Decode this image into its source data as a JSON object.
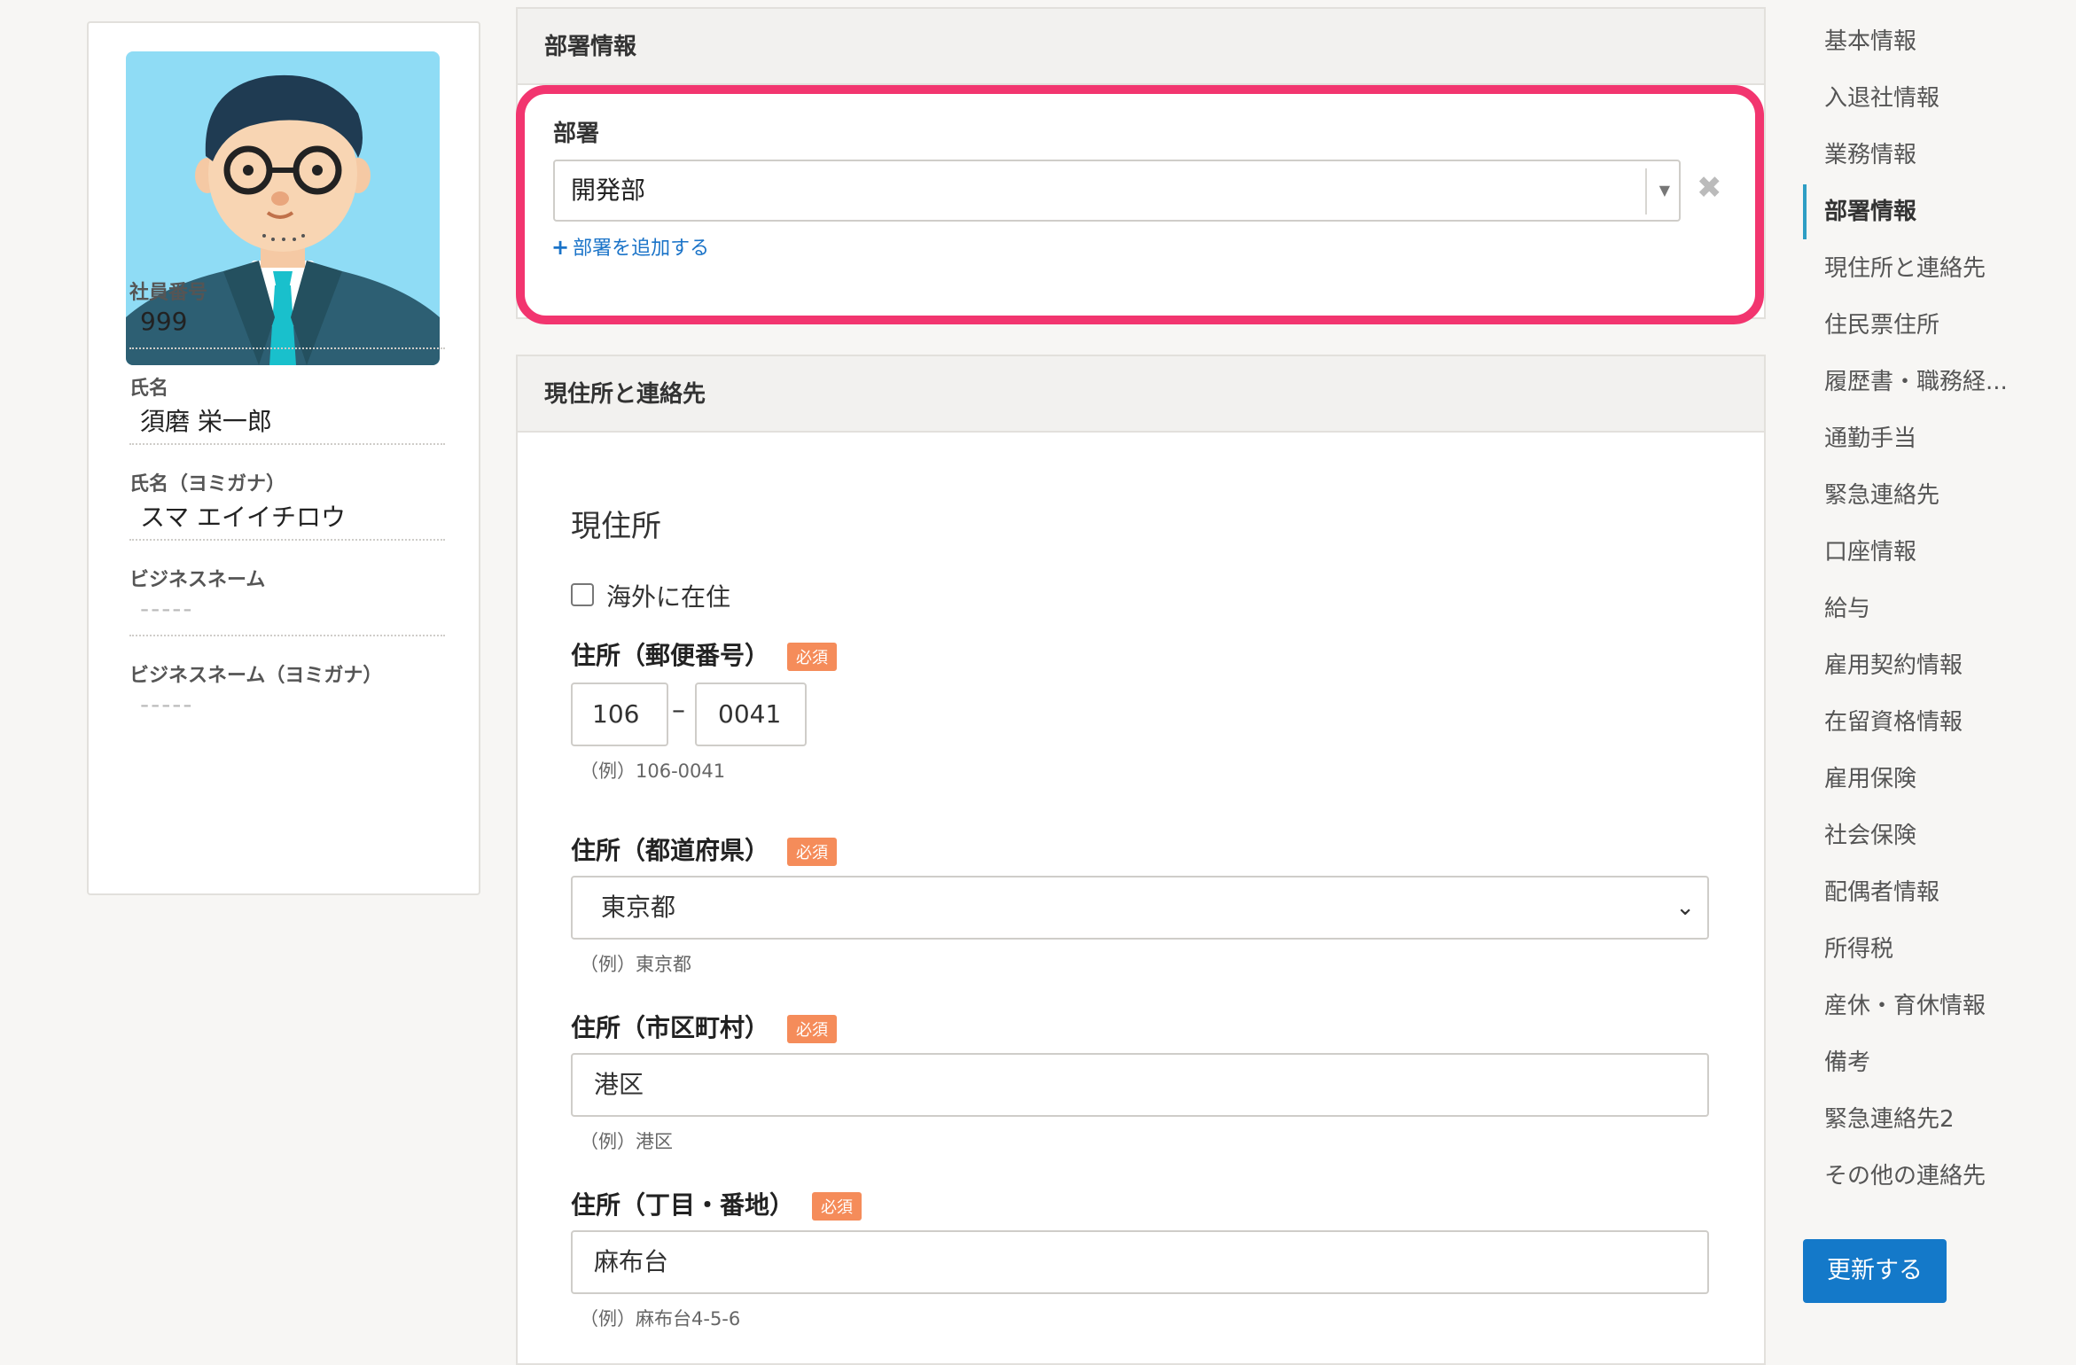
{
  "profile": {
    "fields": [
      {
        "label": "社員番号",
        "value": "999"
      },
      {
        "label": "氏名",
        "value": "須磨 栄一郎"
      },
      {
        "label": "氏名（ヨミガナ）",
        "value": "スマ エイイチロウ"
      },
      {
        "label": "ビジネスネーム",
        "value": "-----"
      },
      {
        "label": "ビジネスネーム（ヨミガナ）",
        "value": "-----"
      }
    ]
  },
  "department_section": {
    "header": "部署情報",
    "field_label": "部署",
    "selected": "開発部",
    "add_link": "部署を追加する"
  },
  "address_section": {
    "header": "現住所と連絡先",
    "subtitle": "現住所",
    "overseas_label": "海外に在住",
    "overseas_checked": false,
    "required_badge": "必須",
    "postal": {
      "label": "住所（郵便番号）",
      "part1": "106",
      "part2": "0041",
      "hint": "（例）106-0041"
    },
    "prefecture": {
      "label": "住所（都道府県）",
      "value": "東京都",
      "hint": "（例）東京都"
    },
    "city": {
      "label": "住所（市区町村）",
      "value": "港区",
      "hint": "（例）港区"
    },
    "street": {
      "label": "住所（丁目・番地）",
      "value": "麻布台",
      "hint": "（例）麻布台4-5-6"
    }
  },
  "nav": {
    "items": [
      "基本情報",
      "入退社情報",
      "業務情報",
      "部署情報",
      "現住所と連絡先",
      "住民票住所",
      "履歴書・職務経...",
      "通勤手当",
      "緊急連絡先",
      "口座情報",
      "給与",
      "雇用契約情報",
      "在留資格情報",
      "雇用保険",
      "社会保険",
      "配偶者情報",
      "所得税",
      "産休・育休情報",
      "備考",
      "緊急連絡先2",
      "その他の連絡先"
    ],
    "active": "部署情報",
    "update_button": "更新する"
  },
  "colors": {
    "highlight": "#f2356f",
    "primary": "#1479c9",
    "badge": "#f58c5a",
    "link": "#1a73c8"
  }
}
